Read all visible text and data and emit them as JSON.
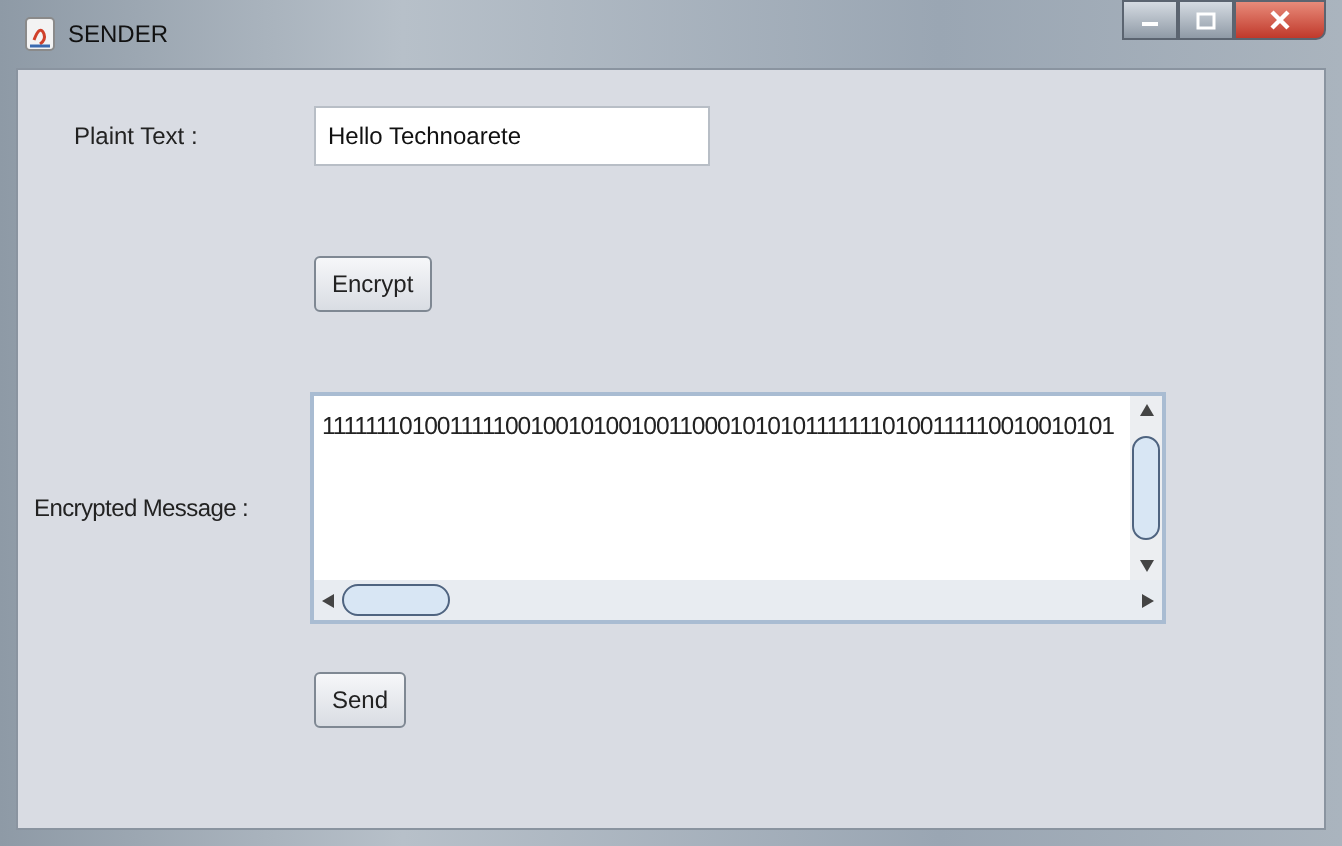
{
  "window": {
    "title": "SENDER"
  },
  "plain_text": {
    "label": "Plaint Text :",
    "value": "Hello Technoarete"
  },
  "encrypt_button": "Encrypt",
  "encrypted_message": {
    "label": "Encrypted Message :",
    "value": "111111101001111100100101001001100010101011111110100111110010010101"
  },
  "send_button": "Send"
}
